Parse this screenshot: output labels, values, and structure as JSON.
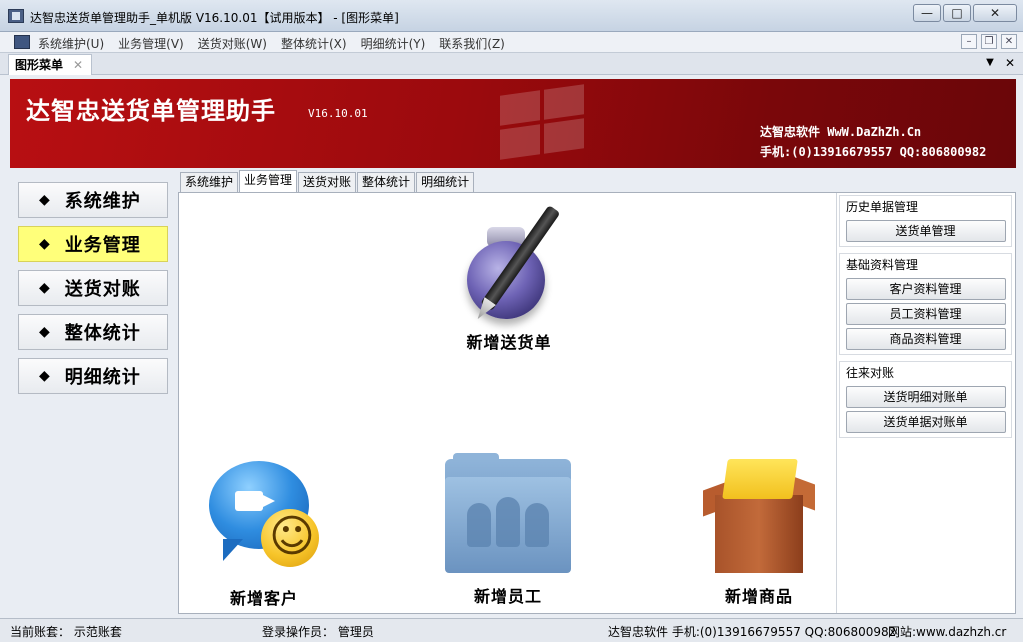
{
  "window": {
    "title": "达智忠送货单管理助手_单机版 V16.10.01【试用版本】 - [图形菜单]",
    "minimize": "—",
    "maximize": "□",
    "close": "✕"
  },
  "menubar": {
    "items": [
      "系统维护(U)",
      "业务管理(V)",
      "送货对账(W)",
      "整体统计(X)",
      "明细统计(Y)",
      "联系我们(Z)"
    ],
    "mdi_min": "–",
    "mdi_restore": "❐",
    "mdi_close": "✕"
  },
  "doctab": {
    "label": "图形菜单",
    "close": "✕",
    "dropdown": "▼",
    "closeall": "✕"
  },
  "banner": {
    "app_name": "达智忠送货单管理助手",
    "version": "V16.10.01",
    "company": "达智忠软件 WwW.DaZhZh.Cn",
    "contact": "手机:(0)13916679557 QQ:806800982"
  },
  "leftnav": {
    "items": [
      "系统维护",
      "业务管理",
      "送货对账",
      "整体统计",
      "明细统计"
    ],
    "active_index": 1,
    "bullet": "◆"
  },
  "subtabs": [
    "系统维护",
    "业务管理",
    "送货对账",
    "整体统计",
    "明细统计"
  ],
  "tiles": {
    "new_delivery": "新增送货单",
    "new_customer": "新增客户",
    "new_employee": "新增员工",
    "new_product": "新增商品"
  },
  "rightpanel": {
    "groups": [
      {
        "title": "历史单据管理",
        "buttons": [
          "送货单管理"
        ]
      },
      {
        "title": "基础资料管理",
        "buttons": [
          "客户资料管理",
          "员工资料管理",
          "商品资料管理"
        ]
      },
      {
        "title": "往来对账",
        "buttons": [
          "送货明细对账单",
          "送货单据对账单"
        ]
      }
    ]
  },
  "statusbar": {
    "account": "当前账套： 示范账套",
    "operator": "登录操作员： 管理员",
    "company": "达智忠软件 手机:(0)13916679557 QQ:806800982",
    "website": "网站:www.dazhzh.cr"
  },
  "colors": {
    "banner_red": "#9b0a0d",
    "active_nav": "#ffff7a"
  }
}
